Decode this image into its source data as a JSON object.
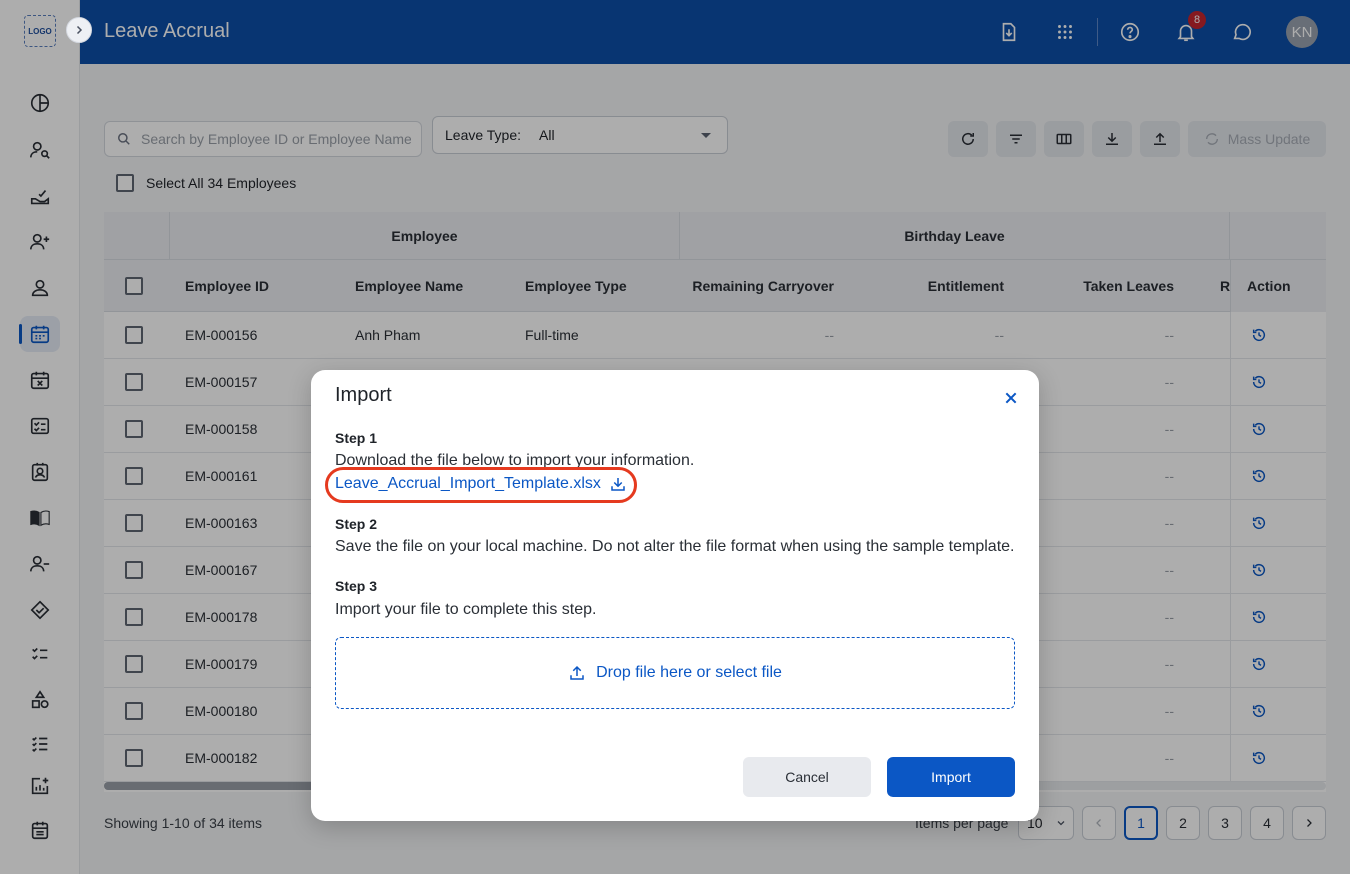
{
  "app": {
    "logo_text": "LOGO",
    "title": "Leave Accrual"
  },
  "header": {
    "notification_count": "8",
    "avatar_initials": "KN"
  },
  "toolbar": {
    "search_placeholder": "Search by Employee ID or Employee Name",
    "leave_type_label": "Leave Type:",
    "leave_type_value": "All",
    "mass_update_label": "Mass Update",
    "select_all_label": "Select All 34 Employees"
  },
  "table": {
    "group_employee": "Employee",
    "group_birthday": "Birthday Leave",
    "headers": {
      "employee_id": "Employee ID",
      "employee_name": "Employee Name",
      "employee_type": "Employee Type",
      "remaining_carryover": "Remaining Carryover",
      "entitlement": "Entitlement",
      "taken_leaves": "Taken Leaves",
      "truncated": "R",
      "action": "Action"
    },
    "rows": [
      {
        "id": "EM-000156",
        "name": "Anh Pham",
        "type": "Full-time",
        "carry": "--",
        "ent": "--",
        "taken": "--"
      },
      {
        "id": "EM-000157",
        "name": "",
        "type": "",
        "carry": "",
        "ent": "",
        "taken": "--"
      },
      {
        "id": "EM-000158",
        "name": "",
        "type": "",
        "carry": "",
        "ent": "",
        "taken": "--"
      },
      {
        "id": "EM-000161",
        "name": "",
        "type": "",
        "carry": "",
        "ent": "",
        "taken": "--"
      },
      {
        "id": "EM-000163",
        "name": "",
        "type": "",
        "carry": "",
        "ent": "",
        "taken": "--"
      },
      {
        "id": "EM-000167",
        "name": "",
        "type": "",
        "carry": "",
        "ent": "",
        "taken": "--"
      },
      {
        "id": "EM-000178",
        "name": "",
        "type": "",
        "carry": "",
        "ent": "",
        "taken": "--"
      },
      {
        "id": "EM-000179",
        "name": "",
        "type": "",
        "carry": "",
        "ent": "",
        "taken": "--"
      },
      {
        "id": "EM-000180",
        "name": "",
        "type": "",
        "carry": "",
        "ent": "",
        "taken": "--"
      },
      {
        "id": "EM-000182",
        "name": "",
        "type": "",
        "carry": "",
        "ent": "",
        "taken": "--"
      }
    ]
  },
  "pagination": {
    "showing": "Showing 1-10 of 34 items",
    "items_per_page_label": "Items per page",
    "items_per_page_value": "10",
    "pages": [
      "1",
      "2",
      "3",
      "4"
    ],
    "current_page": "1"
  },
  "modal": {
    "title": "Import",
    "step1_heading": "Step 1",
    "step1_text": "Download the file below to import your information.",
    "template_filename": "Leave_Accrual_Import_Template.xlsx",
    "step2_heading": "Step 2",
    "step2_text": "Save the file on your local machine. Do not alter the file format when using the sample template.",
    "step3_heading": "Step 3",
    "step3_text": "Import your file to complete this step.",
    "dropzone_label": "Drop file here or select file",
    "cancel_label": "Cancel",
    "import_label": "Import"
  },
  "colors": {
    "brand": "#0c4ea8",
    "accent": "#0b57c5",
    "highlight": "#e53a1f",
    "badge": "#c4262e"
  }
}
